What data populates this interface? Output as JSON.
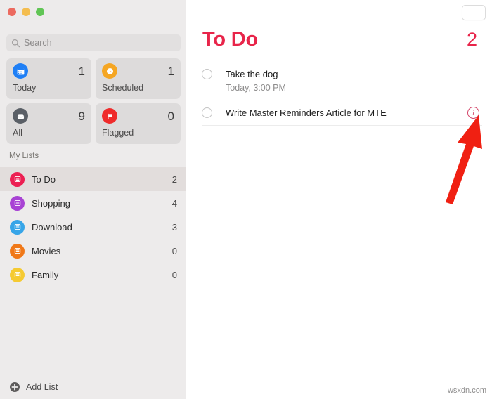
{
  "window": {
    "traffic_lights": [
      {
        "name": "close",
        "color": "#ec6a5f"
      },
      {
        "name": "minimize",
        "color": "#f4bd4f"
      },
      {
        "name": "maximize",
        "color": "#61c555"
      }
    ]
  },
  "sidebar": {
    "search": {
      "value": "",
      "placeholder": "Search",
      "icon": "search-icon"
    },
    "smart_cards": [
      {
        "label": "Today",
        "count": "1",
        "icon": "calendar-icon",
        "color": "#1f7ff5"
      },
      {
        "label": "Scheduled",
        "count": "1",
        "icon": "clock-icon",
        "color": "#f5a623"
      },
      {
        "label": "All",
        "count": "9",
        "icon": "inbox-icon",
        "color": "#5a5f66"
      },
      {
        "label": "Flagged",
        "count": "0",
        "icon": "flag-icon",
        "color": "#ef2b2b"
      }
    ],
    "section_title": "My Lists",
    "lists": [
      {
        "label": "To Do",
        "count": "2",
        "color": "#ec1f52",
        "selected": true
      },
      {
        "label": "Shopping",
        "count": "4",
        "color": "#a843d4",
        "selected": false
      },
      {
        "label": "Download",
        "count": "3",
        "color": "#37a5e8",
        "selected": false
      },
      {
        "label": "Movies",
        "count": "0",
        "color": "#f07818",
        "selected": false
      },
      {
        "label": "Family",
        "count": "0",
        "color": "#f5ca32",
        "selected": false
      }
    ],
    "add_list": {
      "label": "Add List",
      "icon": "plus-circle-icon"
    }
  },
  "main": {
    "add_reminder": {
      "icon": "plus-icon",
      "label": "+"
    },
    "title": "To Do",
    "count": "2",
    "accent_color": "#e8254a",
    "reminders": [
      {
        "title": "Take the dog",
        "subtitle": "Today, 3:00 PM",
        "completed": false,
        "has_info": false
      },
      {
        "title": "Write Master Reminders Article for MTE",
        "subtitle": "",
        "completed": false,
        "has_info": true,
        "info_label": "i"
      }
    ]
  },
  "annotation": {
    "arrow": {
      "color": "#f02012",
      "points_to": "info-button"
    }
  },
  "watermark": "wsxdn.com"
}
